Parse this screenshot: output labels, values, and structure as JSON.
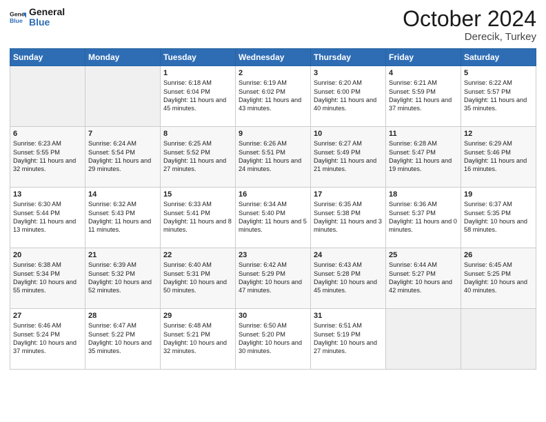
{
  "header": {
    "logo_line1": "General",
    "logo_line2": "Blue",
    "month": "October 2024",
    "location": "Derecik, Turkey"
  },
  "days_of_week": [
    "Sunday",
    "Monday",
    "Tuesday",
    "Wednesday",
    "Thursday",
    "Friday",
    "Saturday"
  ],
  "weeks": [
    [
      {
        "day": "",
        "empty": true
      },
      {
        "day": "",
        "empty": true
      },
      {
        "day": "1",
        "sunrise": "6:18 AM",
        "sunset": "6:04 PM",
        "daylight": "11 hours and 45 minutes."
      },
      {
        "day": "2",
        "sunrise": "6:19 AM",
        "sunset": "6:02 PM",
        "daylight": "11 hours and 43 minutes."
      },
      {
        "day": "3",
        "sunrise": "6:20 AM",
        "sunset": "6:00 PM",
        "daylight": "11 hours and 40 minutes."
      },
      {
        "day": "4",
        "sunrise": "6:21 AM",
        "sunset": "5:59 PM",
        "daylight": "11 hours and 37 minutes."
      },
      {
        "day": "5",
        "sunrise": "6:22 AM",
        "sunset": "5:57 PM",
        "daylight": "11 hours and 35 minutes."
      }
    ],
    [
      {
        "day": "6",
        "sunrise": "6:23 AM",
        "sunset": "5:55 PM",
        "daylight": "11 hours and 32 minutes."
      },
      {
        "day": "7",
        "sunrise": "6:24 AM",
        "sunset": "5:54 PM",
        "daylight": "11 hours and 29 minutes."
      },
      {
        "day": "8",
        "sunrise": "6:25 AM",
        "sunset": "5:52 PM",
        "daylight": "11 hours and 27 minutes."
      },
      {
        "day": "9",
        "sunrise": "6:26 AM",
        "sunset": "5:51 PM",
        "daylight": "11 hours and 24 minutes."
      },
      {
        "day": "10",
        "sunrise": "6:27 AM",
        "sunset": "5:49 PM",
        "daylight": "11 hours and 21 minutes."
      },
      {
        "day": "11",
        "sunrise": "6:28 AM",
        "sunset": "5:47 PM",
        "daylight": "11 hours and 19 minutes."
      },
      {
        "day": "12",
        "sunrise": "6:29 AM",
        "sunset": "5:46 PM",
        "daylight": "11 hours and 16 minutes."
      }
    ],
    [
      {
        "day": "13",
        "sunrise": "6:30 AM",
        "sunset": "5:44 PM",
        "daylight": "11 hours and 13 minutes."
      },
      {
        "day": "14",
        "sunrise": "6:32 AM",
        "sunset": "5:43 PM",
        "daylight": "11 hours and 11 minutes."
      },
      {
        "day": "15",
        "sunrise": "6:33 AM",
        "sunset": "5:41 PM",
        "daylight": "11 hours and 8 minutes."
      },
      {
        "day": "16",
        "sunrise": "6:34 AM",
        "sunset": "5:40 PM",
        "daylight": "11 hours and 5 minutes."
      },
      {
        "day": "17",
        "sunrise": "6:35 AM",
        "sunset": "5:38 PM",
        "daylight": "11 hours and 3 minutes."
      },
      {
        "day": "18",
        "sunrise": "6:36 AM",
        "sunset": "5:37 PM",
        "daylight": "11 hours and 0 minutes."
      },
      {
        "day": "19",
        "sunrise": "6:37 AM",
        "sunset": "5:35 PM",
        "daylight": "10 hours and 58 minutes."
      }
    ],
    [
      {
        "day": "20",
        "sunrise": "6:38 AM",
        "sunset": "5:34 PM",
        "daylight": "10 hours and 55 minutes."
      },
      {
        "day": "21",
        "sunrise": "6:39 AM",
        "sunset": "5:32 PM",
        "daylight": "10 hours and 52 minutes."
      },
      {
        "day": "22",
        "sunrise": "6:40 AM",
        "sunset": "5:31 PM",
        "daylight": "10 hours and 50 minutes."
      },
      {
        "day": "23",
        "sunrise": "6:42 AM",
        "sunset": "5:29 PM",
        "daylight": "10 hours and 47 minutes."
      },
      {
        "day": "24",
        "sunrise": "6:43 AM",
        "sunset": "5:28 PM",
        "daylight": "10 hours and 45 minutes."
      },
      {
        "day": "25",
        "sunrise": "6:44 AM",
        "sunset": "5:27 PM",
        "daylight": "10 hours and 42 minutes."
      },
      {
        "day": "26",
        "sunrise": "6:45 AM",
        "sunset": "5:25 PM",
        "daylight": "10 hours and 40 minutes."
      }
    ],
    [
      {
        "day": "27",
        "sunrise": "6:46 AM",
        "sunset": "5:24 PM",
        "daylight": "10 hours and 37 minutes."
      },
      {
        "day": "28",
        "sunrise": "6:47 AM",
        "sunset": "5:22 PM",
        "daylight": "10 hours and 35 minutes."
      },
      {
        "day": "29",
        "sunrise": "6:48 AM",
        "sunset": "5:21 PM",
        "daylight": "10 hours and 32 minutes."
      },
      {
        "day": "30",
        "sunrise": "6:50 AM",
        "sunset": "5:20 PM",
        "daylight": "10 hours and 30 minutes."
      },
      {
        "day": "31",
        "sunrise": "6:51 AM",
        "sunset": "5:19 PM",
        "daylight": "10 hours and 27 minutes."
      },
      {
        "day": "",
        "empty": true
      },
      {
        "day": "",
        "empty": true
      }
    ]
  ],
  "labels": {
    "sunrise": "Sunrise:",
    "sunset": "Sunset:",
    "daylight": "Daylight:"
  }
}
